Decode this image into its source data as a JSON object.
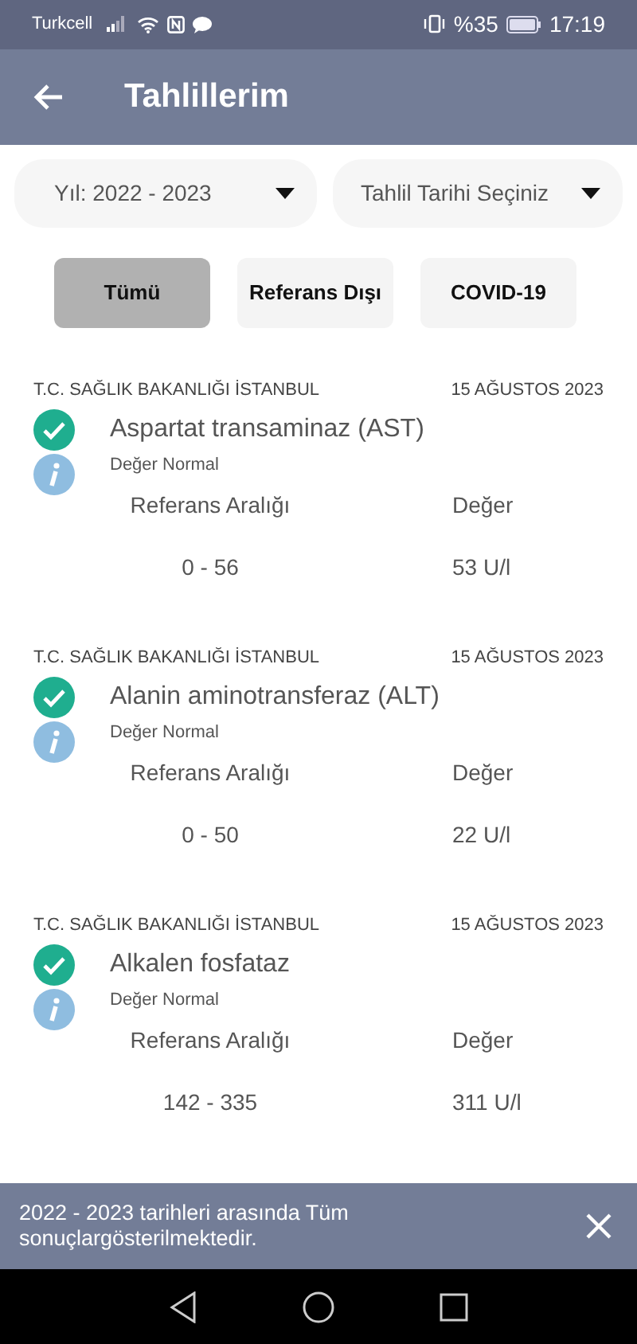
{
  "status_bar": {
    "carrier": "Turkcell",
    "battery": "%35",
    "time": "17:19"
  },
  "app_bar": {
    "title": "Tahlillerim"
  },
  "dropdowns": [
    {
      "value": "Yıl: 2022 - 2023"
    },
    {
      "value": "Tahlil Tarihi Seçiniz"
    }
  ],
  "filters": [
    {
      "label": "Tümü",
      "selected": true
    },
    {
      "label": "Referans Dışı",
      "selected": false
    },
    {
      "label": "COVID-19",
      "selected": false
    }
  ],
  "results": [
    {
      "institution": "T.C. SAĞLIK BAKANLIĞI İSTANBUL",
      "date": "15 AĞUSTOS 2023",
      "test": "Aspartat transaminaz (AST)",
      "normal": true,
      "status": "Değer Normal",
      "range_label": "Referans Aralığı",
      "value_label": "Değer",
      "range": "0 - 56",
      "value": "53 U/l"
    },
    {
      "institution": "T.C. SAĞLIK BAKANLIĞI İSTANBUL",
      "date": "15 AĞUSTOS 2023",
      "test": "Alanin aminotransferaz (ALT)",
      "normal": true,
      "status": "Değer Normal",
      "range_label": "Referans Aralığı",
      "value_label": "Değer",
      "range": "0 - 50",
      "value": "22 U/l"
    },
    {
      "institution": "T.C. SAĞLIK BAKANLIĞI İSTANBUL",
      "date": "15 AĞUSTOS 2023",
      "test": "Alkalen fosfataz",
      "normal": true,
      "status": "Değer Normal",
      "range_label": "Referans Aralığı",
      "value_label": "Değer",
      "range": "142 - 335",
      "value": "311 U/l"
    }
  ],
  "snackbar": {
    "message": "2022 - 2023 tarihleri arasında Tüm sonuçlargösterilmektedir."
  }
}
